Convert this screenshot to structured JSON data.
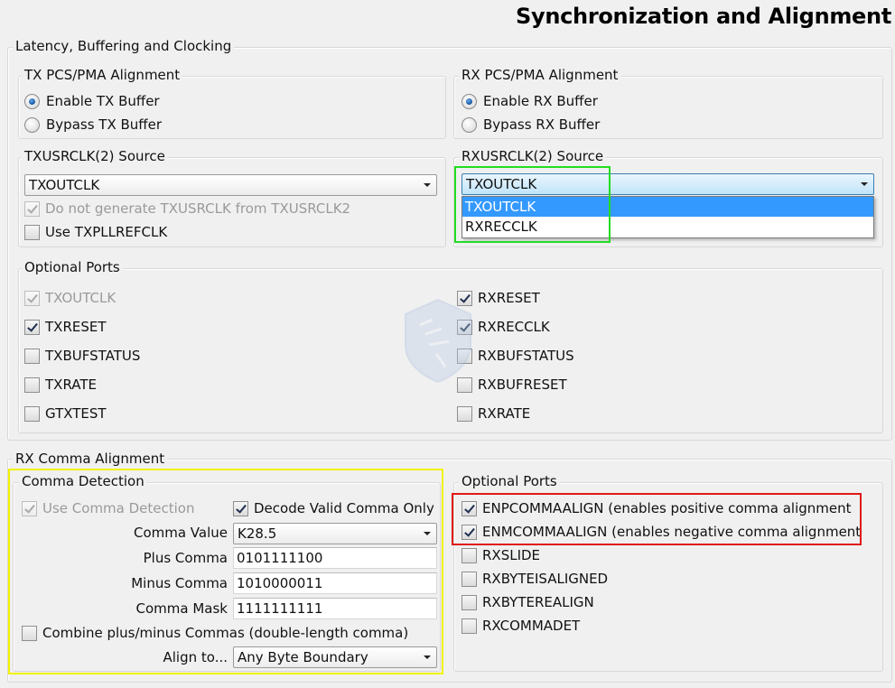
{
  "title": "Synchronization and Alignment",
  "latency": {
    "label": "Latency, Buffering and Clocking",
    "tx_align": {
      "label": "TX PCS/PMA Alignment",
      "options": [
        "Enable TX Buffer",
        "Bypass TX Buffer"
      ],
      "selected": "Enable TX Buffer"
    },
    "rx_align": {
      "label": "RX PCS/PMA Alignment",
      "options": [
        "Enable RX Buffer",
        "Bypass RX Buffer"
      ],
      "selected": "Enable RX Buffer"
    },
    "txusrclk": {
      "label": "TXUSRCLK(2) Source",
      "value": "TXOUTCLK",
      "no_generate": "Do not generate TXUSRCLK from TXUSRCLK2",
      "use_txpllrefclk": "Use TXPLLREFCLK"
    },
    "rxusrclk": {
      "label": "RXUSRCLK(2) Source",
      "value": "TXOUTCLK",
      "options": [
        "TXOUTCLK",
        "RXRECCLK"
      ],
      "highlighted": "TXOUTCLK"
    },
    "optional_ports": {
      "label": "Optional Ports",
      "left": [
        {
          "label": "TXOUTCLK",
          "checked": true,
          "disabled": true
        },
        {
          "label": "TXRESET",
          "checked": true,
          "disabled": false
        },
        {
          "label": "TXBUFSTATUS",
          "checked": false,
          "disabled": false
        },
        {
          "label": "TXRATE",
          "checked": false,
          "disabled": false
        },
        {
          "label": "GTXTEST",
          "checked": false,
          "disabled": false
        }
      ],
      "right": [
        {
          "label": "RXRESET",
          "checked": true,
          "disabled": false
        },
        {
          "label": "RXRECCLK",
          "checked": true,
          "disabled": false
        },
        {
          "label": "RXBUFSTATUS",
          "checked": false,
          "disabled": false
        },
        {
          "label": "RXBUFRESET",
          "checked": false,
          "disabled": false
        },
        {
          "label": "RXRATE",
          "checked": false,
          "disabled": false
        }
      ]
    }
  },
  "comma": {
    "label": "RX Comma Alignment",
    "detection": {
      "label": "Comma Detection",
      "use_comma_detection": "Use Comma Detection",
      "decode_valid": "Decode Valid Comma Only",
      "comma_value_label": "Comma Value",
      "comma_value": "K28.5",
      "plus_label": "Plus Comma",
      "plus_value": "0101111100",
      "minus_label": "Minus Comma",
      "minus_value": "1010000011",
      "mask_label": "Comma Mask",
      "mask_value": "1111111111",
      "combine": "Combine plus/minus Commas (double-length comma)",
      "align_label": "Align to...",
      "align_value": "Any Byte Boundary"
    },
    "optional_ports": {
      "label": "Optional Ports",
      "items": [
        {
          "label": "ENPCOMMAALIGN (enables positive comma alignment",
          "checked": true
        },
        {
          "label": "ENMCOMMAALIGN (enables negative comma alignment",
          "checked": true
        },
        {
          "label": "RXSLIDE",
          "checked": false
        },
        {
          "label": "RXBYTEISALIGNED",
          "checked": false
        },
        {
          "label": "RXBYTEREALIGN",
          "checked": false
        },
        {
          "label": "RXCOMMADET",
          "checked": false
        }
      ]
    }
  },
  "colors": {
    "highlight_green": "#22dd22",
    "highlight_red": "#e01818",
    "highlight_yellow": "#f2f200",
    "selection_blue": "#3399ff"
  }
}
